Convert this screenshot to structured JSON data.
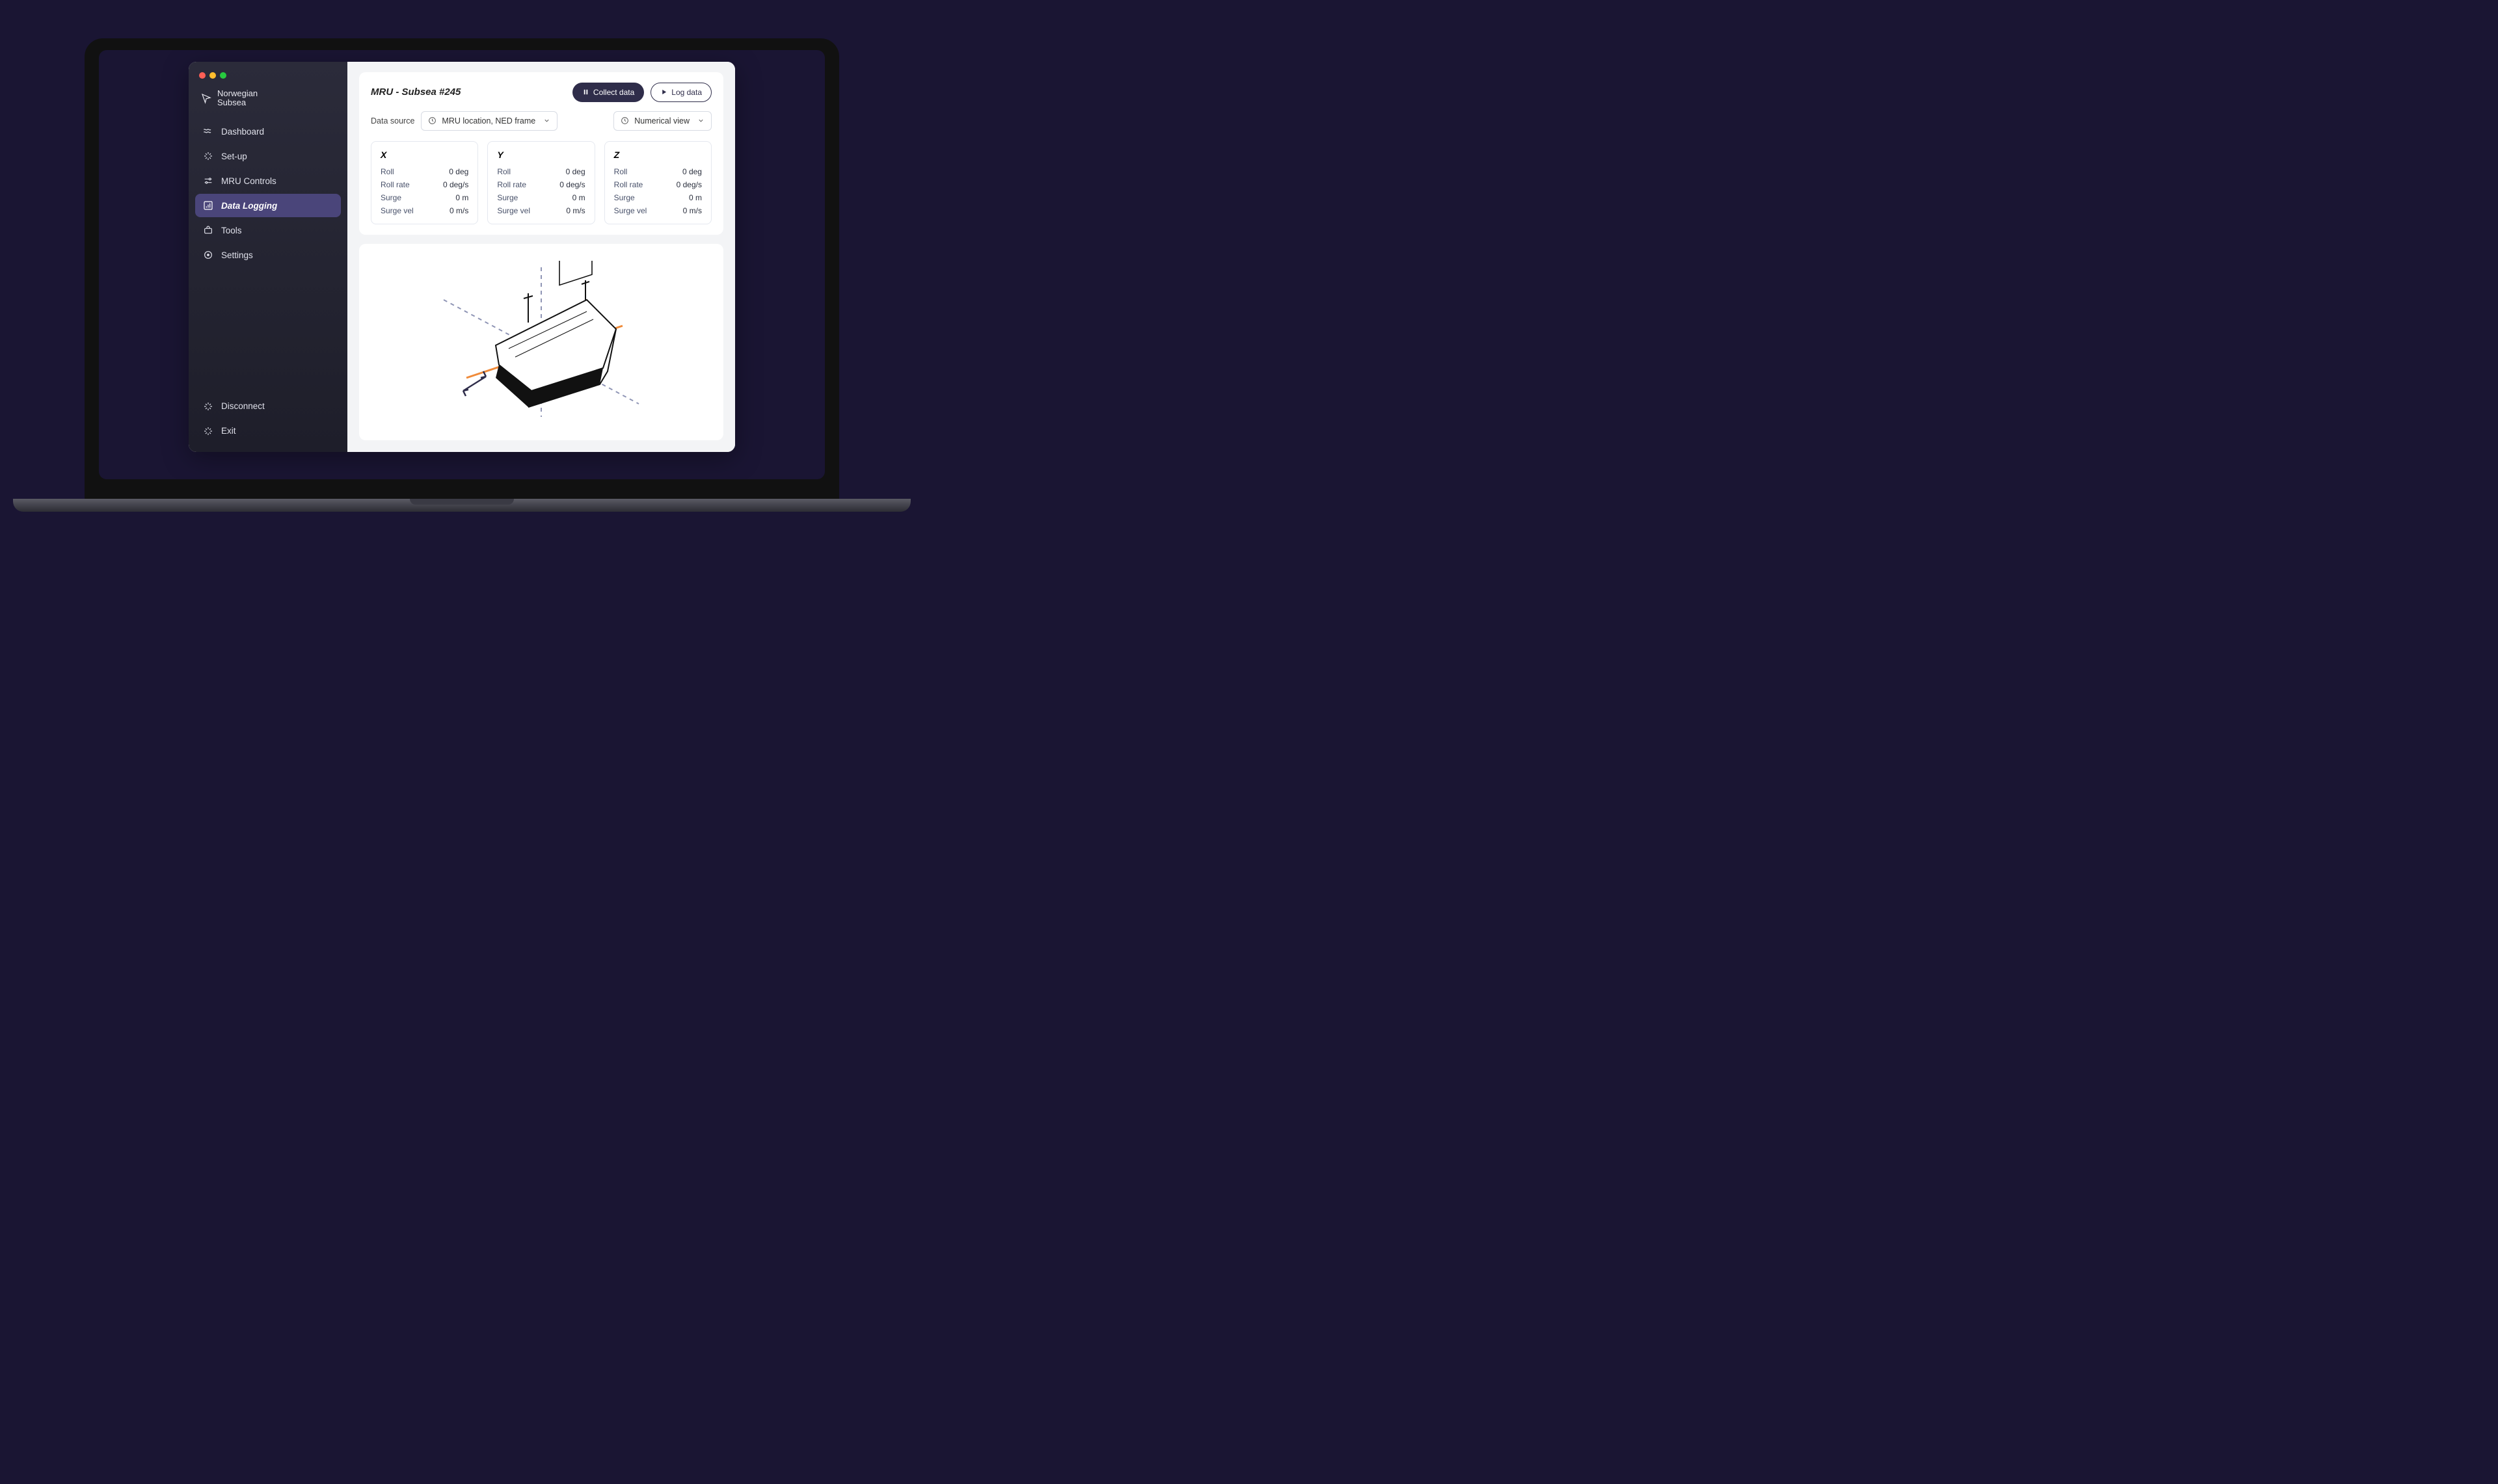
{
  "brand": {
    "line1": "Norwegian",
    "line2": "Subsea"
  },
  "sidebar": {
    "items": [
      {
        "label": "Dashboard"
      },
      {
        "label": "Set-up"
      },
      {
        "label": "MRU Controls"
      },
      {
        "label": "Data Logging",
        "active": true
      },
      {
        "label": "Tools"
      },
      {
        "label": "Settings"
      }
    ],
    "bottom": [
      {
        "label": "Disconnect"
      },
      {
        "label": "Exit"
      }
    ]
  },
  "header": {
    "title": "MRU - Subsea #245",
    "collect_label": "Collect data",
    "log_label": "Log data"
  },
  "controls": {
    "data_source_label": "Data source",
    "data_source_value": "MRU location, NED frame",
    "view_value": "Numerical view"
  },
  "metrics": {
    "labels": {
      "roll": "Roll",
      "roll_rate": "Roll rate",
      "surge": "Surge",
      "surge_vel": "Surge vel"
    },
    "axes": [
      {
        "name": "X",
        "roll": "0 deg",
        "roll_rate": "0 deg/s",
        "surge": "0 m",
        "surge_vel": "0 m/s"
      },
      {
        "name": "Y",
        "roll": "0 deg",
        "roll_rate": "0 deg/s",
        "surge": "0 m",
        "surge_vel": "0 m/s"
      },
      {
        "name": "Z",
        "roll": "0 deg",
        "roll_rate": "0 deg/s",
        "surge": "0 m",
        "surge_vel": "0 m/s"
      }
    ]
  }
}
